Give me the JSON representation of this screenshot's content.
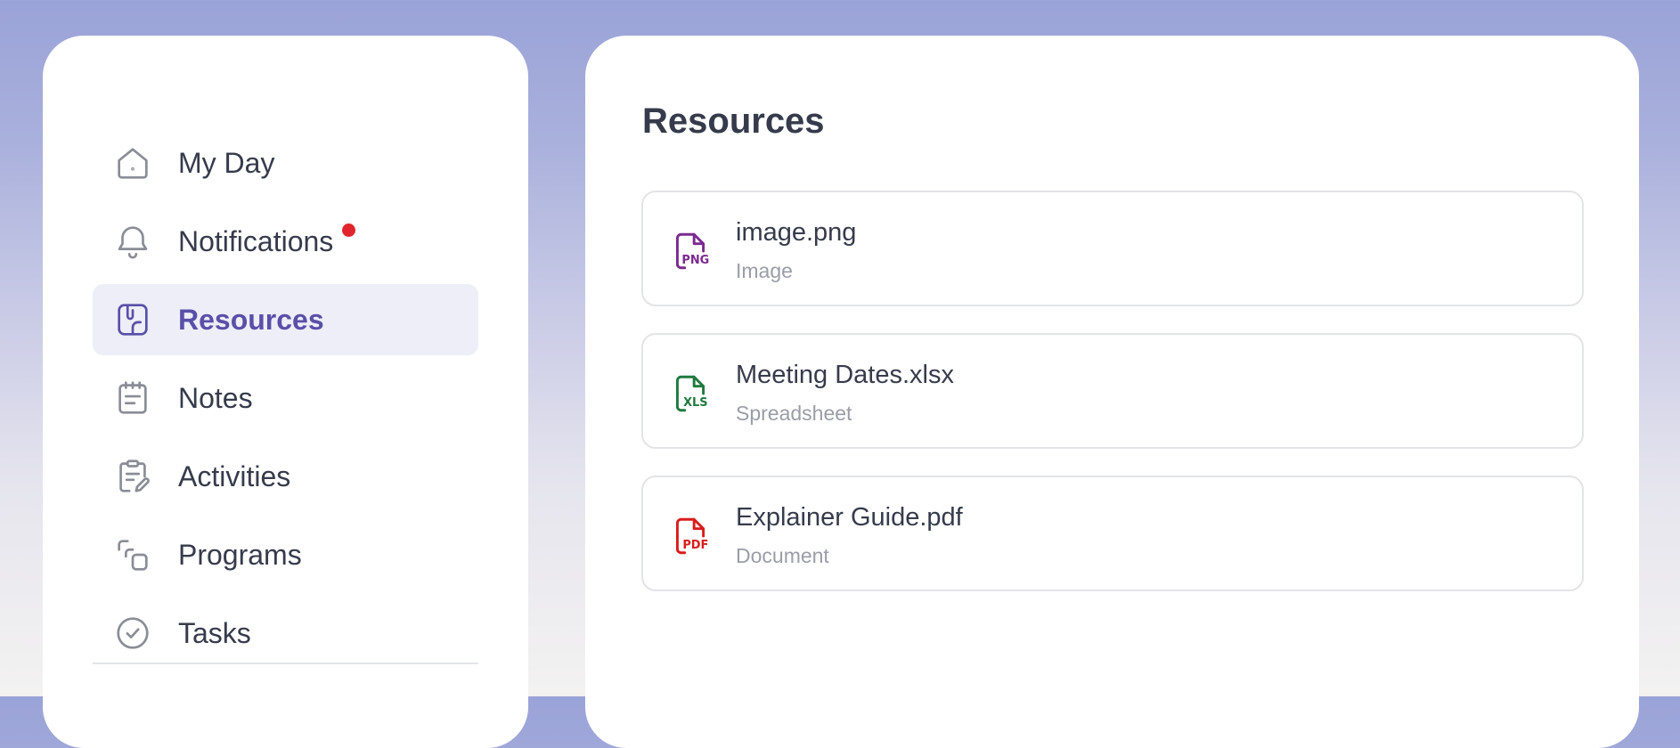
{
  "sidebar": {
    "items": [
      {
        "label": "My Day",
        "icon": "home-icon",
        "active": false,
        "has_notification_dot": false
      },
      {
        "label": "Notifications",
        "icon": "bell-icon",
        "active": false,
        "has_notification_dot": true
      },
      {
        "label": "Resources",
        "icon": "paperclip-icon",
        "active": true,
        "has_notification_dot": false
      },
      {
        "label": "Notes",
        "icon": "notepad-icon",
        "active": false,
        "has_notification_dot": false
      },
      {
        "label": "Activities",
        "icon": "clipboard-edit-icon",
        "active": false,
        "has_notification_dot": false
      },
      {
        "label": "Programs",
        "icon": "copy-squares-icon",
        "active": false,
        "has_notification_dot": false
      },
      {
        "label": "Tasks",
        "icon": "check-circle-icon",
        "active": false,
        "has_notification_dot": false
      }
    ]
  },
  "main": {
    "title": "Resources",
    "resources": [
      {
        "name": "image.png",
        "type": "Image",
        "icon": "png-file-icon",
        "color": "#7b2a8f",
        "badge": "PNG"
      },
      {
        "name": "Meeting Dates.xlsx",
        "type": "Spreadsheet",
        "icon": "xls-file-icon",
        "color": "#1f7a3e",
        "badge": "XLS"
      },
      {
        "name": "Explainer Guide.pdf",
        "type": "Document",
        "icon": "pdf-file-icon",
        "color": "#d91c1c",
        "badge": "PDF"
      }
    ]
  },
  "colors": {
    "accent": "#5a4fa8",
    "active_bg": "#edeef7",
    "notification_dot": "#e0262b",
    "text_primary": "#363b4c",
    "text_secondary": "#9a9da7"
  }
}
